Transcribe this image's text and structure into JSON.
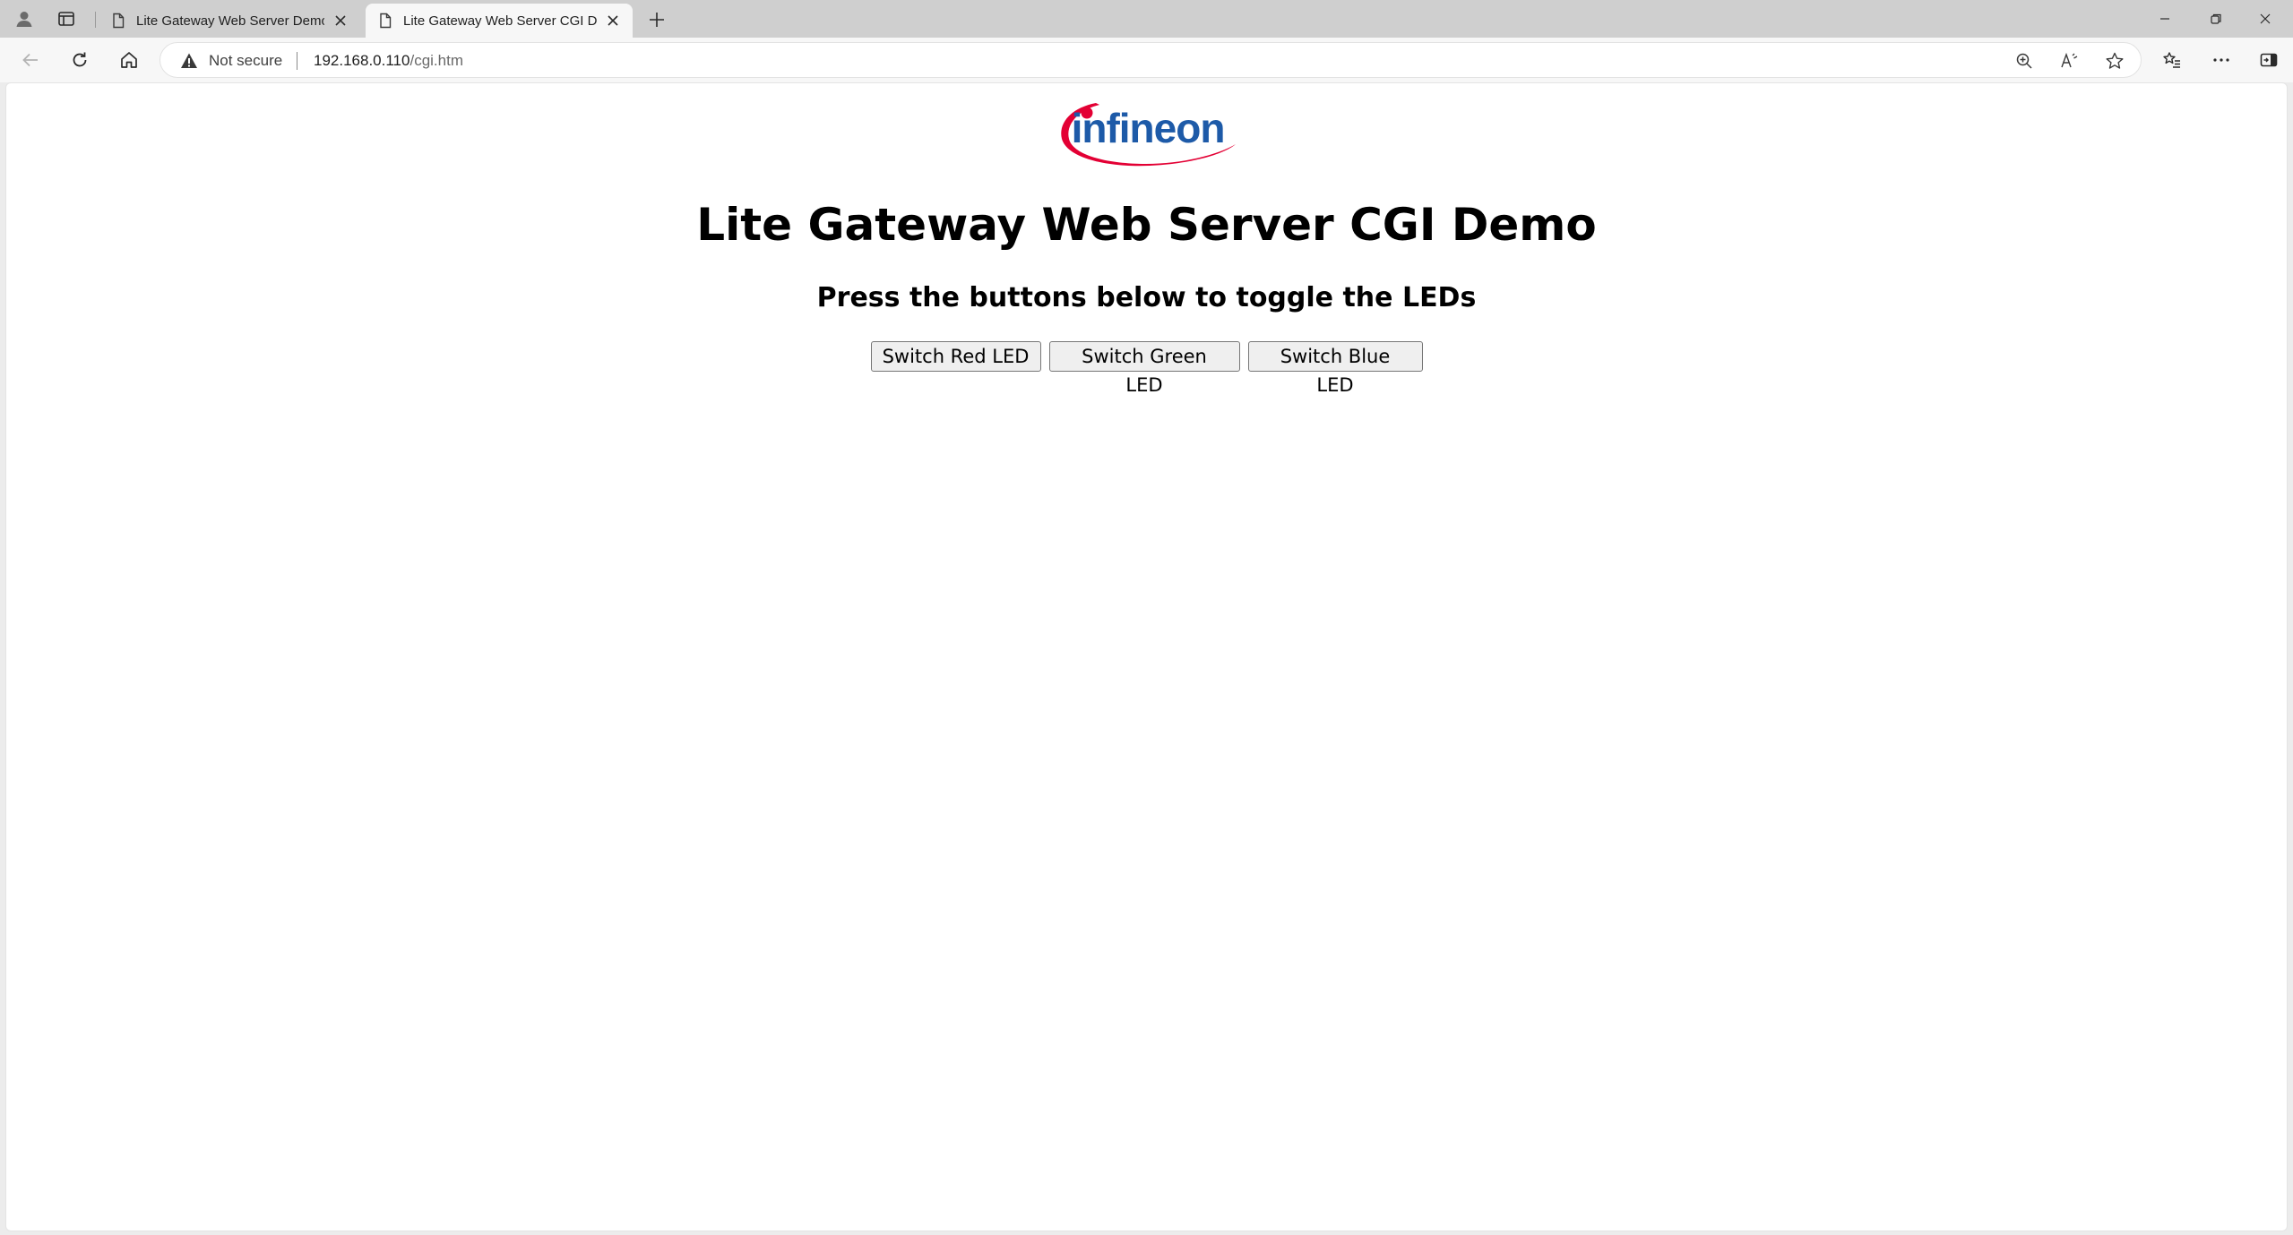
{
  "browser": {
    "tabs": [
      {
        "title": "Lite Gateway Web Server Demo",
        "active": false
      },
      {
        "title": "Lite Gateway Web Server CGI Demo",
        "active": true
      }
    ],
    "address_bar": {
      "security_status": "Not secure",
      "url_host": "192.168.0.110",
      "url_path": "/cgi.htm"
    },
    "icons": {
      "profile": "profile-icon",
      "workspaces": "workspaces-icon",
      "new_tab": "plus-icon",
      "back": "back-arrow-icon",
      "reload": "reload-icon",
      "home": "home-icon",
      "warning": "warning-icon",
      "zoom": "zoom-icon",
      "read_aloud": "read-aloud-icon",
      "favorite": "star-icon",
      "favorites": "favorites-icon",
      "more": "more-icon",
      "sidebar": "sidebar-icon"
    },
    "colors": {
      "tabstrip_bg": "#cfcfcf",
      "toolbar_bg": "#f7f7f7"
    }
  },
  "page": {
    "logo_text": "infineon",
    "title": "Lite Gateway Web Server CGI Demo",
    "subtitle": "Press the buttons below to toggle the LEDs",
    "buttons": {
      "red": "Switch Red LED",
      "green": "Switch Green LED",
      "blue": "Switch Blue LED"
    },
    "colors": {
      "logo_red": "#e30034",
      "logo_blue": "#1d5aa8"
    }
  }
}
